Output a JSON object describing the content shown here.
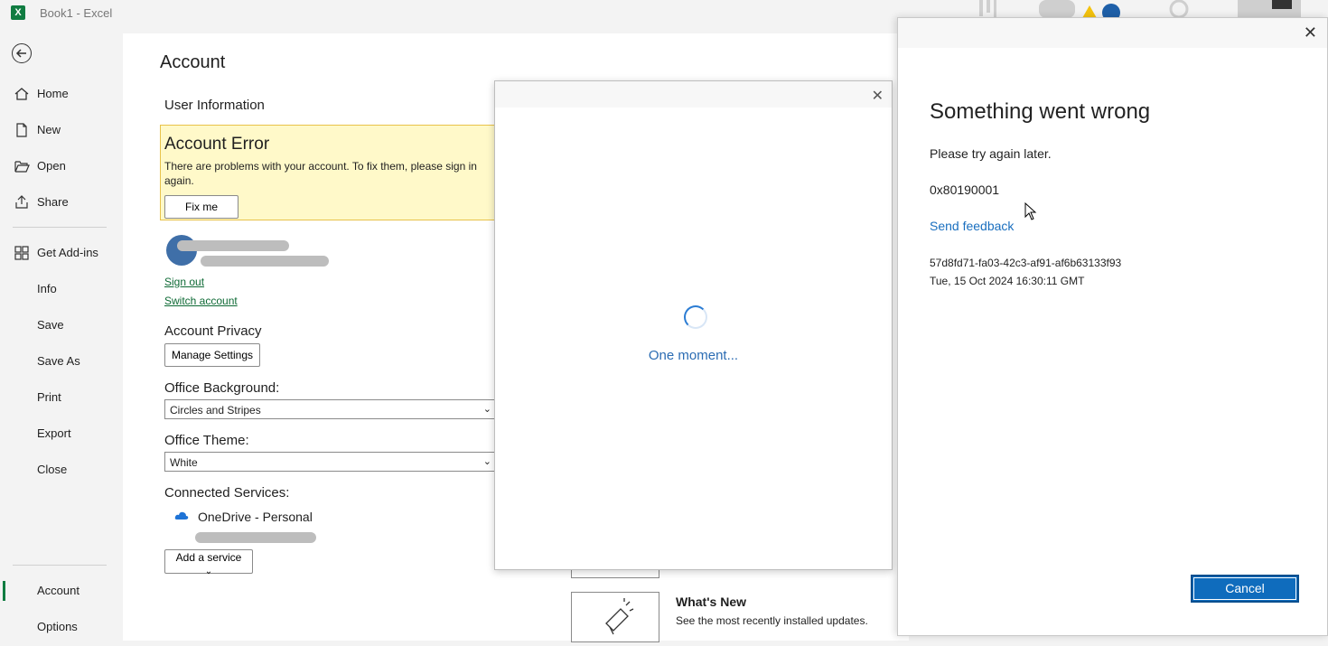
{
  "titlebar": {
    "app_title": "Book1  -  Excel",
    "logo": "X"
  },
  "sidebar": {
    "items": [
      {
        "label": "Home",
        "icon": "home-icon"
      },
      {
        "label": "New",
        "icon": "new-document-icon"
      },
      {
        "label": "Open",
        "icon": "folder-open-icon"
      },
      {
        "label": "Share",
        "icon": "share-icon"
      },
      {
        "label": "Get Add-ins",
        "icon": "grid-icon"
      },
      {
        "label": "Info"
      },
      {
        "label": "Save"
      },
      {
        "label": "Save As"
      },
      {
        "label": "Print"
      },
      {
        "label": "Export"
      },
      {
        "label": "Close"
      },
      {
        "label": "Account",
        "active": true
      },
      {
        "label": "Options"
      }
    ]
  },
  "account": {
    "title": "Account",
    "user_info_heading": "User Information",
    "error_title": "Account Error",
    "error_text": "There are problems with your account. To fix them, please sign in again.",
    "fix_button": "Fix me",
    "sign_out": "Sign out",
    "switch_account": "Switch account",
    "privacy_heading": "Account Privacy",
    "manage_settings": "Manage Settings",
    "background_label": "Office Background:",
    "background_value": "Circles and Stripes",
    "theme_label": "Office Theme:",
    "theme_value": "White",
    "connected_label": "Connected Services:",
    "onedrive": "OneDrive - Personal",
    "add_service": "Add a service"
  },
  "whats_new": {
    "title": "What's New",
    "desc": "See the most recently installed updates."
  },
  "loading_dialog": {
    "message": "One moment..."
  },
  "error_dialog": {
    "title": "Something went wrong",
    "message": "Please try again later.",
    "code": "0x80190001",
    "feedback_link": "Send feedback",
    "correlation_id": "57d8fd71-fa03-42c3-af91-af6b63133f93",
    "timestamp": "Tue, 15 Oct 2024 16:30:11 GMT",
    "cancel": "Cancel"
  },
  "colors": {
    "accent": "#107c41",
    "link_blue": "#1a6fbf",
    "primary_button": "#0f6cbd",
    "warning_bg": "#fff9c9"
  }
}
